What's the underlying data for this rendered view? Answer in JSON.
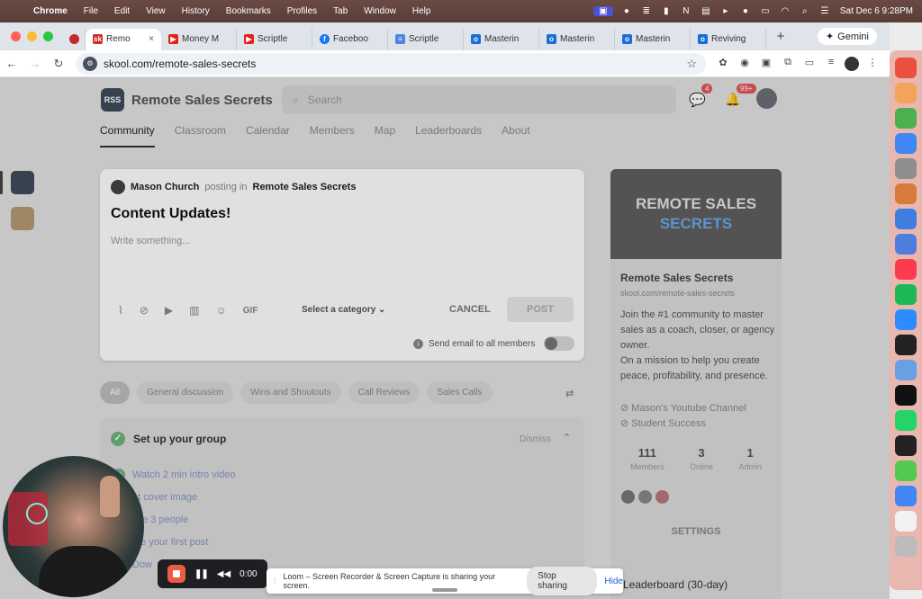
{
  "menubar": {
    "app": "Chrome",
    "items": [
      "File",
      "Edit",
      "View",
      "History",
      "Bookmarks",
      "Profiles",
      "Tab",
      "Window",
      "Help"
    ],
    "clock": "Sat Dec 6  9:28PM"
  },
  "tabs": [
    {
      "label": "Remo",
      "color": "#cc2b2b",
      "glyph": "sk",
      "active": true
    },
    {
      "label": "Money M",
      "color": "#e62117",
      "glyph": "▶"
    },
    {
      "label": "Scriptle",
      "color": "#e62117",
      "glyph": "▶"
    },
    {
      "label": "Faceboo",
      "color": "#1877f2",
      "glyph": "f"
    },
    {
      "label": "Scriptle",
      "color": "#4a86e8",
      "glyph": "≡"
    },
    {
      "label": "Masterin",
      "color": "#1a6ed8",
      "glyph": "o"
    },
    {
      "label": "Masterin",
      "color": "#1a6ed8",
      "glyph": "o"
    },
    {
      "label": "Masterin",
      "color": "#1a6ed8",
      "glyph": "o"
    },
    {
      "label": "Reviving",
      "color": "#1a6ed8",
      "glyph": "o"
    }
  ],
  "gemini_label": "Gemini",
  "url": "skool.com/remote-sales-secrets",
  "group": {
    "logo_text": "RSS",
    "name": "Remote Sales Secrets",
    "search_placeholder": "Search",
    "chat_count": "4",
    "notif_count": "99+"
  },
  "nav": [
    "Community",
    "Classroom",
    "Calendar",
    "Members",
    "Map",
    "Leaderboards",
    "About"
  ],
  "composer": {
    "author": "Mason Church",
    "posting_in": "posting in",
    "group": "Remote Sales Secrets",
    "title": "Content Updates!",
    "placeholder": "Write something...",
    "gif": "GIF",
    "category": "Select a category",
    "cancel": "CANCEL",
    "post": "POST",
    "email_option": "Send email to all members"
  },
  "filters": [
    "All",
    "General discussion",
    "Wins and Shoutouts",
    "Call Reviews",
    "Sales Calls"
  ],
  "setup": {
    "title": "Set up your group",
    "dismiss": "Dismiss",
    "steps": [
      "Watch 2 min intro video",
      "et cover image",
      "vite 3 people",
      "rite your first post",
      "Dow"
    ]
  },
  "sidebar": {
    "cover_line1": "REMOTE SALES",
    "cover_line2": "SECRETS",
    "name": "Remote Sales Secrets",
    "url": "skool.com/remote-sales-secrets",
    "description_1": "Join the #1 community to master sales as a coach, closer, or agency owner.",
    "description_2": "On a mission to help you create peace, profitability, and presence.",
    "link1": "Mason's Youtube Channel",
    "link2": "Student Success",
    "stats": [
      {
        "value": "111",
        "label": "Members"
      },
      {
        "value": "3",
        "label": "Online"
      },
      {
        "value": "1",
        "label": "Admin"
      }
    ],
    "settings": "SETTINGS",
    "leaderboard": "Leaderboard (30-day)"
  },
  "loom": {
    "time": "0:00",
    "share_text": "Loom – Screen Recorder & Screen Capture is sharing your screen.",
    "stop_sharing": "Stop sharing",
    "hide": "Hide"
  },
  "dock_colors": [
    "#e9503d",
    "#f3a35a",
    "#4caf50",
    "#4285f4",
    "#8e8e8e",
    "#d87b3a",
    "#3f7de0",
    "#4f7dde",
    "#fb3c4f",
    "#1db954",
    "#2d8cff",
    "#222",
    "#6b9fe3",
    "#111",
    "#25d366",
    "#222",
    "#52c94f",
    "#4285f4",
    "#f2f2f2",
    "#bbb"
  ]
}
